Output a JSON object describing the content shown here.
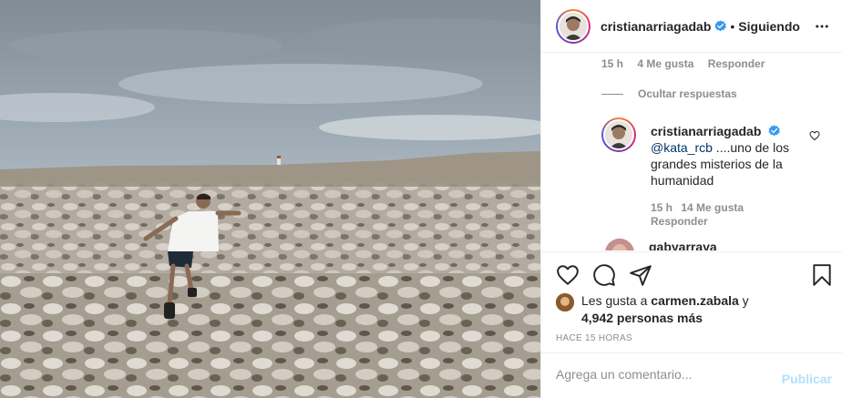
{
  "post": {
    "author": "cristianarriagadab",
    "follow_status": "Siguiendo",
    "separator": "•"
  },
  "comments": {
    "previous_meta": {
      "time": "15 h",
      "likes": "4 Me gusta",
      "reply": "Responder"
    },
    "hide_replies": "Ocultar respuestas",
    "reply": {
      "username": "cristianarriagadab",
      "mention": "@kata_rcb",
      "text": " ....uno de los grandes misterios de la humanidad",
      "time": "15 h",
      "likes": "14 Me gusta",
      "reply": "Responder"
    },
    "next_username": "gabyarraya"
  },
  "likes": {
    "prefix": "Les gusta a ",
    "user": "carmen.zabala",
    "suffix": " y",
    "count": "4,942 personas más"
  },
  "timestamp": "HACE 15 HORAS",
  "add_comment": {
    "placeholder": "Agrega un comentario...",
    "publish": "Publicar"
  },
  "colors": {
    "verified": "#3897f0",
    "publish_disabled": "#b2dffc",
    "mention": "#00376b",
    "muted": "#8e8e8e"
  }
}
